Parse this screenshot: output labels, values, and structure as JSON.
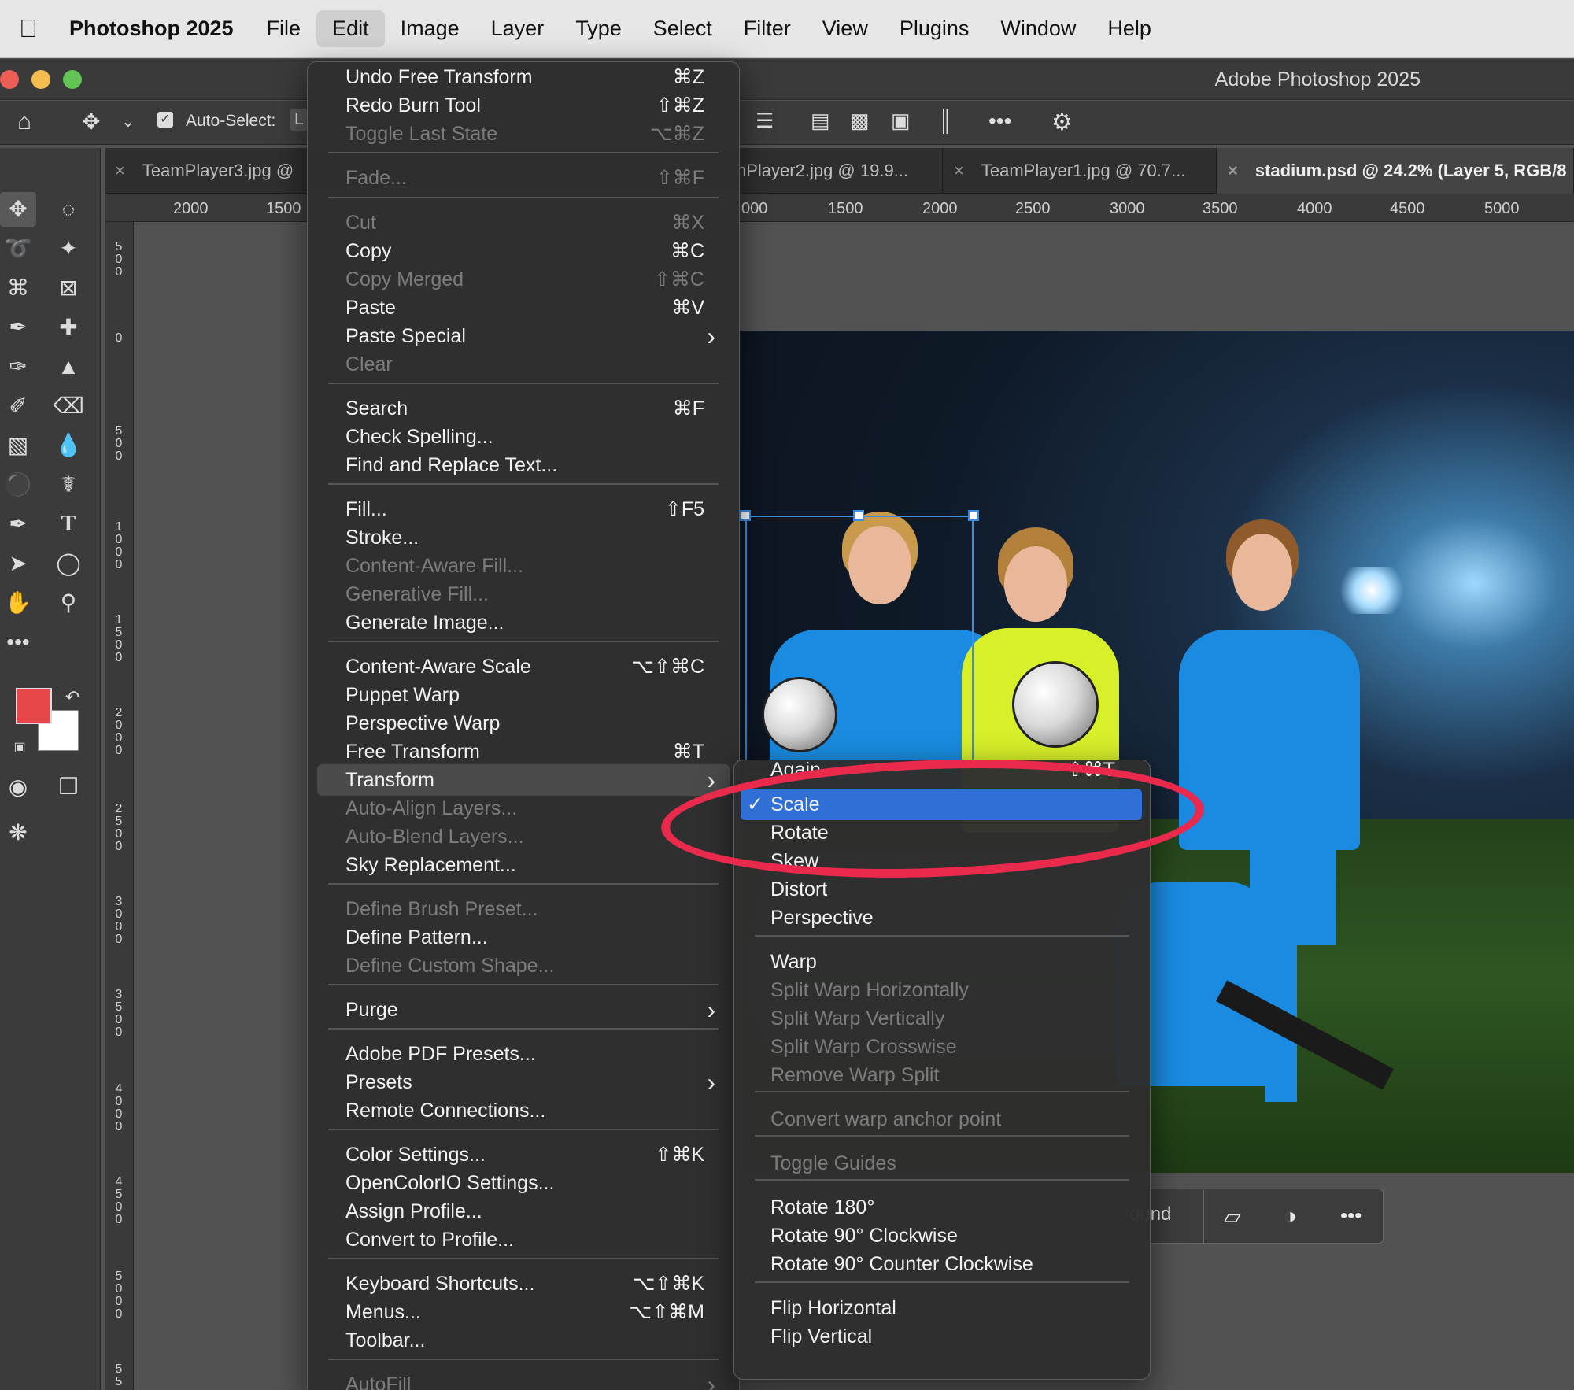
{
  "menubar": {
    "app": "Photoshop 2025",
    "items": [
      "File",
      "Edit",
      "Image",
      "Layer",
      "Type",
      "Select",
      "Filter",
      "View",
      "Plugins",
      "Window",
      "Help"
    ]
  },
  "window": {
    "title": "Adobe Photoshop 2025"
  },
  "options": {
    "auto_select_label": "Auto-Select:",
    "auto_select_value": "L"
  },
  "tabs": [
    {
      "label": "TeamPlayer3.jpg @"
    },
    {
      "label": "nPlayer2.jpg @ 19.9..."
    },
    {
      "label": "TeamPlayer1.jpg @ 70.7..."
    },
    {
      "label": "stadium.psd @ 24.2% (Layer 5, RGB/8"
    }
  ],
  "ruler": {
    "h": [
      "2000",
      "1500",
      "000",
      "1500",
      "2000",
      "2500",
      "3000",
      "3500",
      "4000",
      "4500",
      "5000"
    ],
    "v": [
      "500",
      "0",
      "500",
      "1000",
      "1500",
      "2000",
      "2500",
      "3000",
      "3500",
      "4000",
      "4500",
      "5000",
      "55"
    ]
  },
  "edit_menu": {
    "items": [
      {
        "label": "Undo Free Transform",
        "shortcut": "⌘Z",
        "enabled": true
      },
      {
        "label": "Redo Burn Tool",
        "shortcut": "⇧⌘Z",
        "enabled": true
      },
      {
        "label": "Toggle Last State",
        "shortcut": "⌥⌘Z",
        "enabled": false
      },
      {
        "label": "Fade...",
        "shortcut": "⇧⌘F",
        "enabled": false
      },
      {
        "label": "Cut",
        "shortcut": "⌘X",
        "enabled": false
      },
      {
        "label": "Copy",
        "shortcut": "⌘C",
        "enabled": true
      },
      {
        "label": "Copy Merged",
        "shortcut": "⇧⌘C",
        "enabled": false
      },
      {
        "label": "Paste",
        "shortcut": "⌘V",
        "enabled": true
      },
      {
        "label": "Paste Special",
        "shortcut": "",
        "enabled": true,
        "submenu": true
      },
      {
        "label": "Clear",
        "shortcut": "",
        "enabled": false
      },
      {
        "label": "Search",
        "shortcut": "⌘F",
        "enabled": true
      },
      {
        "label": "Check Spelling...",
        "shortcut": "",
        "enabled": true
      },
      {
        "label": "Find and Replace Text...",
        "shortcut": "",
        "enabled": true
      },
      {
        "label": "Fill...",
        "shortcut": "⇧F5",
        "enabled": true
      },
      {
        "label": "Stroke...",
        "shortcut": "",
        "enabled": true
      },
      {
        "label": "Content-Aware Fill...",
        "shortcut": "",
        "enabled": false
      },
      {
        "label": "Generative Fill...",
        "shortcut": "",
        "enabled": false
      },
      {
        "label": "Generate Image...",
        "shortcut": "",
        "enabled": true
      },
      {
        "label": "Content-Aware Scale",
        "shortcut": "⌥⇧⌘C",
        "enabled": true
      },
      {
        "label": "Puppet Warp",
        "shortcut": "",
        "enabled": true
      },
      {
        "label": "Perspective Warp",
        "shortcut": "",
        "enabled": true
      },
      {
        "label": "Free Transform",
        "shortcut": "⌘T",
        "enabled": true
      },
      {
        "label": "Transform",
        "shortcut": "",
        "enabled": true,
        "submenu": true,
        "highlighted": true
      },
      {
        "label": "Auto-Align Layers...",
        "shortcut": "",
        "enabled": false
      },
      {
        "label": "Auto-Blend Layers...",
        "shortcut": "",
        "enabled": false
      },
      {
        "label": "Sky Replacement...",
        "shortcut": "",
        "enabled": true
      },
      {
        "label": "Define Brush Preset...",
        "shortcut": "",
        "enabled": false
      },
      {
        "label": "Define Pattern...",
        "shortcut": "",
        "enabled": true
      },
      {
        "label": "Define Custom Shape...",
        "shortcut": "",
        "enabled": false
      },
      {
        "label": "Purge",
        "shortcut": "",
        "enabled": true,
        "submenu": true
      },
      {
        "label": "Adobe PDF Presets...",
        "shortcut": "",
        "enabled": true
      },
      {
        "label": "Presets",
        "shortcut": "",
        "enabled": true,
        "submenu": true
      },
      {
        "label": "Remote Connections...",
        "shortcut": "",
        "enabled": true
      },
      {
        "label": "Color Settings...",
        "shortcut": "⇧⌘K",
        "enabled": true
      },
      {
        "label": "OpenColorIO Settings...",
        "shortcut": "",
        "enabled": true
      },
      {
        "label": "Assign Profile...",
        "shortcut": "",
        "enabled": true
      },
      {
        "label": "Convert to Profile...",
        "shortcut": "",
        "enabled": true
      },
      {
        "label": "Keyboard Shortcuts...",
        "shortcut": "⌥⇧⌘K",
        "enabled": true
      },
      {
        "label": "Menus...",
        "shortcut": "⌥⇧⌘M",
        "enabled": true
      },
      {
        "label": "Toolbar...",
        "shortcut": "",
        "enabled": true
      },
      {
        "label": "AutoFill",
        "shortcut": "",
        "enabled": false,
        "submenu": true
      }
    ]
  },
  "transform_menu": {
    "items": [
      {
        "label": "Again",
        "shortcut": "⇧⌘T",
        "enabled": true
      },
      {
        "label": "Scale",
        "checked": true,
        "enabled": true
      },
      {
        "label": "Rotate",
        "enabled": true
      },
      {
        "label": "Skew",
        "enabled": true
      },
      {
        "label": "Distort",
        "enabled": true
      },
      {
        "label": "Perspective",
        "enabled": true
      },
      {
        "label": "Warp",
        "enabled": true
      },
      {
        "label": "Split Warp Horizontally",
        "enabled": false
      },
      {
        "label": "Split Warp Vertically",
        "enabled": false
      },
      {
        "label": "Split Warp Crosswise",
        "enabled": false
      },
      {
        "label": "Remove Warp Split",
        "enabled": false
      },
      {
        "label": "Convert warp anchor point",
        "enabled": false
      },
      {
        "label": "Toggle Guides",
        "enabled": false
      },
      {
        "label": "Rotate 180°",
        "enabled": true
      },
      {
        "label": "Rotate 90° Clockwise",
        "enabled": true
      },
      {
        "label": "Rotate 90° Counter Clockwise",
        "enabled": true
      },
      {
        "label": "Flip Horizontal",
        "enabled": true
      },
      {
        "label": "Flip Vertical",
        "enabled": true
      }
    ]
  },
  "context_bar": {
    "label": "ound"
  },
  "colors": {
    "foreground": "#e8474a",
    "background": "#ffffff",
    "highlight": "#2f6fd6",
    "annotation": "#ea2a4d"
  }
}
